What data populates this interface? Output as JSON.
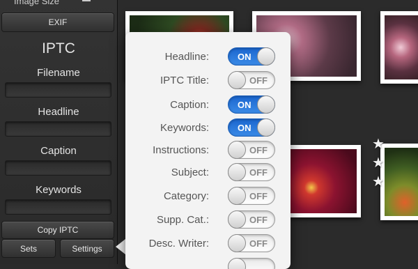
{
  "sidebar": {
    "top_label": "Image Size",
    "exif_button": "EXIF",
    "section_title": "IPTC",
    "fields": [
      {
        "label": "Filename"
      },
      {
        "label": "Headline"
      },
      {
        "label": "Caption"
      },
      {
        "label": "Keywords"
      }
    ],
    "copy_iptc_button": "Copy IPTC",
    "sets_button": "Sets",
    "settings_button": "Settings"
  },
  "popover": {
    "rows": [
      {
        "label": "Headline:",
        "state": "ON"
      },
      {
        "label": "IPTC Title:",
        "state": "OFF"
      },
      {
        "label": "Caption:",
        "state": "ON"
      },
      {
        "label": "Keywords:",
        "state": "ON"
      },
      {
        "label": "Instructions:",
        "state": "OFF"
      },
      {
        "label": "Subject:",
        "state": "OFF"
      },
      {
        "label": "Category:",
        "state": "OFF"
      },
      {
        "label": "Supp. Cat.:",
        "state": "OFF"
      },
      {
        "label": "Desc. Writer:",
        "state": "OFF"
      }
    ]
  },
  "colors": {
    "toggle_on": "#1b66cf",
    "toggle_off": "#f5f5f5",
    "background": "#2b2b2b"
  }
}
